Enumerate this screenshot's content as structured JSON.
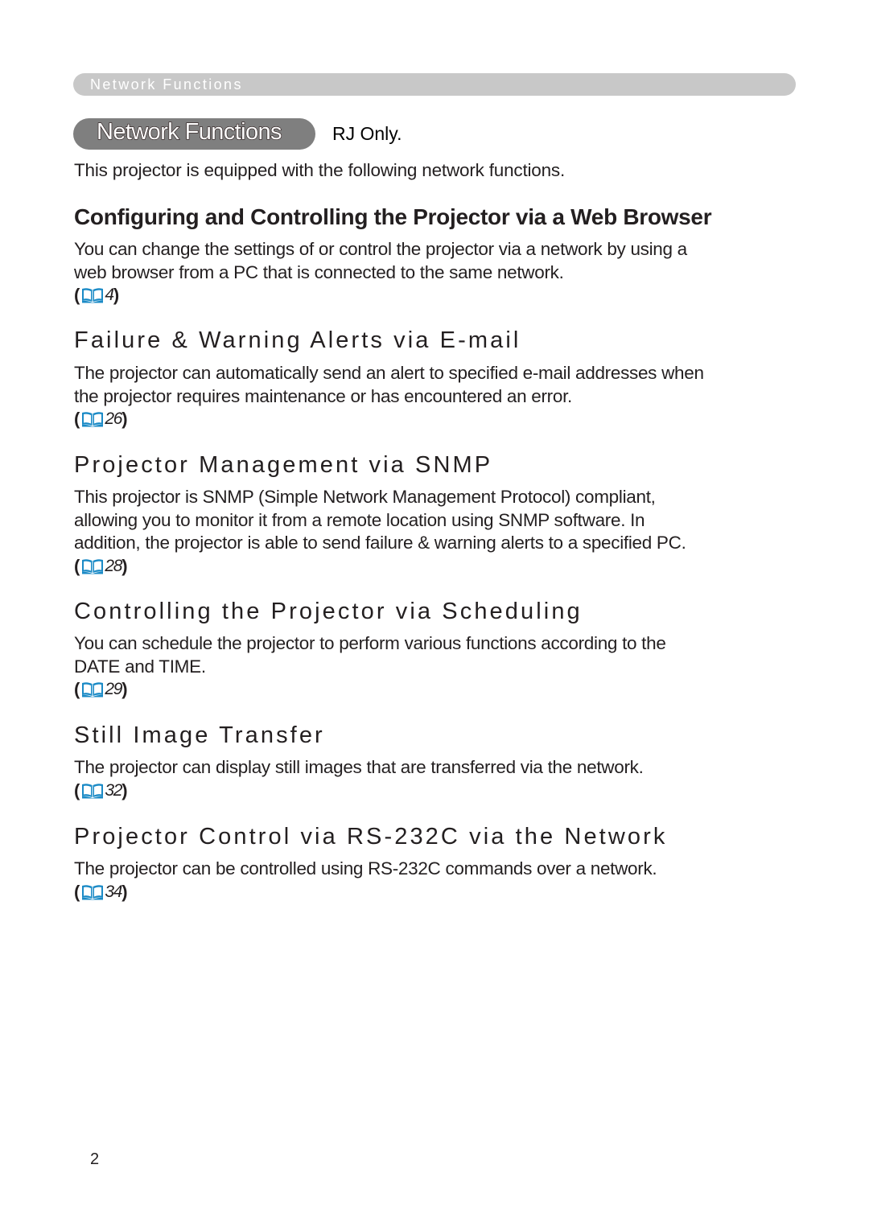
{
  "header": {
    "running_title": "Network Functions"
  },
  "title": {
    "label": "Network Functions",
    "qualifier": "RJ Only."
  },
  "intro": "This projector is equipped with the following network functions.",
  "sections": [
    {
      "heading": "Configuring and Controlling the Projector via a Web Browser",
      "lines": [
        "You can change the settings of or control the projector via a network by using a",
        "web browser from a PC that is connected to the same network."
      ],
      "ref_page": "4",
      "ref_icon": "book-icon"
    },
    {
      "heading": "Failure & Warning Alerts via E-mail",
      "lines": [
        "The projector can automatically send an alert to specified e-mail addresses when",
        "the projector requires maintenance or has encountered an error."
      ],
      "ref_page": "26",
      "ref_icon": "book-icon"
    },
    {
      "heading": "Projector Management via SNMP",
      "lines": [
        "This projector is SNMP (Simple Network Management Protocol) compliant,",
        "allowing you to monitor it from a remote location using SNMP software. In",
        "addition, the projector is able to send failure & warning alerts to a specified PC."
      ],
      "ref_page": "28",
      "ref_icon": "book-icon"
    },
    {
      "heading": "Controlling the Projector via Scheduling",
      "lines": [
        "You can schedule the projector to perform various functions according to the",
        "DATE and TIME."
      ],
      "ref_page": "29",
      "ref_icon": "book-icon"
    },
    {
      "heading": "Still Image Transfer",
      "lines": [
        "The projector can display still images that are transferred via the network."
      ],
      "ref_page": "32",
      "ref_icon": "book-icon"
    },
    {
      "heading": "Projector Control via RS-232C via the Network",
      "lines": [
        "The projector can be controlled using RS-232C commands over a network."
      ],
      "ref_page": "34",
      "ref_icon": "book-icon"
    }
  ],
  "ref_parens": {
    "open": "(",
    "close": ")"
  },
  "footer": {
    "page_number": "2"
  },
  "colors": {
    "header_bar": "#c8c8c8",
    "title_pill": "#7f7f7f",
    "text": "#231f20",
    "book_icon": "#1a8ac6"
  }
}
